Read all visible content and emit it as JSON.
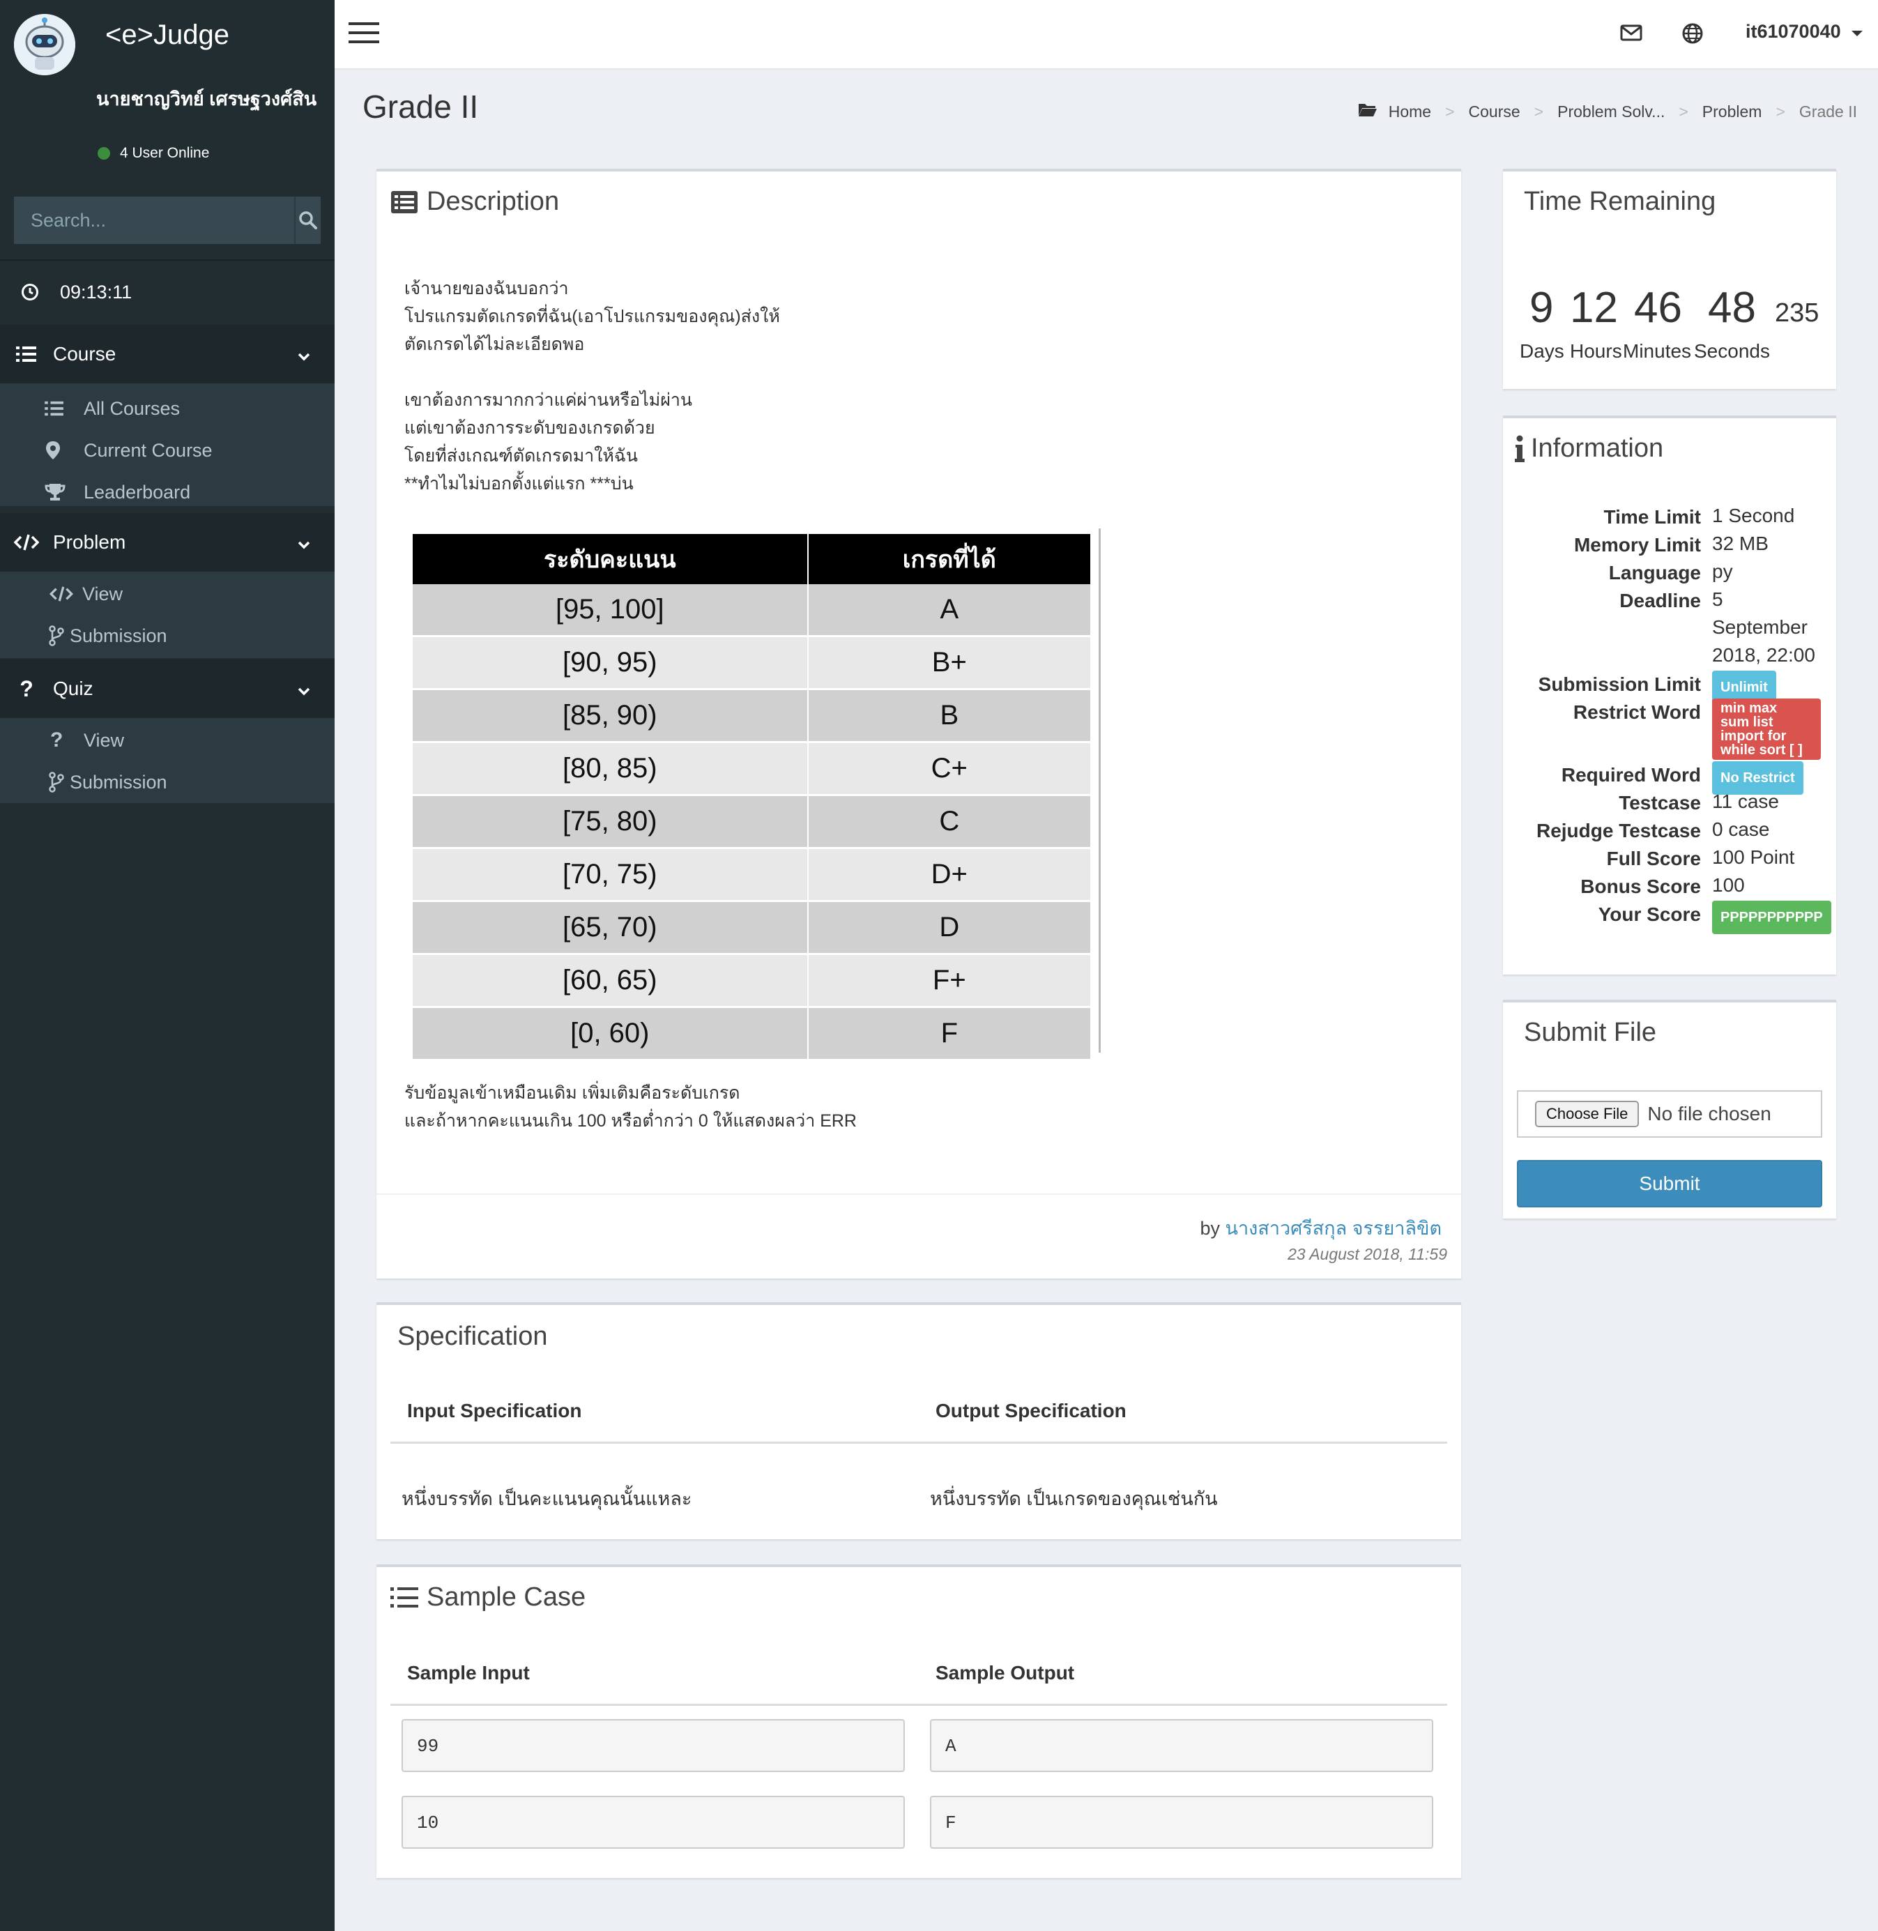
{
  "app": {
    "logo": "<e>Judge"
  },
  "user": {
    "name": "นายชาญวิทย์ เศรษฐวงศ์สิน",
    "online_text": "4 User Online",
    "username": "it61070040"
  },
  "search": {
    "placeholder": "Search..."
  },
  "clock": "09:13:11",
  "sidebar": {
    "course": {
      "label": "Course",
      "items": [
        "All Courses",
        "Current Course",
        "Leaderboard"
      ]
    },
    "problem": {
      "label": "Problem",
      "items": [
        "View",
        "Submission"
      ]
    },
    "quiz": {
      "label": "Quiz",
      "items": [
        "View",
        "Submission"
      ]
    }
  },
  "page": {
    "title": "Grade II"
  },
  "breadcrumb": [
    "Home",
    "Course",
    "Problem Solv...",
    "Problem",
    "Grade II"
  ],
  "description": {
    "title": "Description",
    "paragraph1": [
      "เจ้านายของฉันบอกว่า",
      "โปรแกรมตัดเกรดที่ฉัน(เอาโปรแกรมของคุณ)ส่งให้",
      "ตัดเกรดได้ไม่ละเอียดพอ"
    ],
    "paragraph2": [
      "เขาต้องการมากกว่าแค่ผ่านหรือไม่ผ่าน",
      "แต่เขาต้องการระดับของเกรดด้วย",
      "โดยที่ส่งเกณฑ์ตัดเกรดมาให้ฉัน",
      "**ทำไมไม่บอกตั้งแต่แรก ***บ่น"
    ],
    "table_headers": [
      "ระดับคะแนน",
      "เกรดที่ได้"
    ],
    "table_rows": [
      [
        "[95, 100]",
        "A"
      ],
      [
        "[90, 95)",
        "B+"
      ],
      [
        "[85, 90)",
        "B"
      ],
      [
        "[80, 85)",
        "C+"
      ],
      [
        "[75, 80)",
        "C"
      ],
      [
        "[70, 75)",
        "D+"
      ],
      [
        "[65, 70)",
        "D"
      ],
      [
        "[60, 65)",
        "F+"
      ],
      [
        "[0, 60)",
        "F"
      ]
    ],
    "paragraph3": [
      "รับข้อมูลเข้าเหมือนเดิม เพิ่มเติมคือระดับเกรด",
      "และถ้าหากคะแนนเกิน 100 หรือต่ำกว่า 0 ให้แสดงผลว่า ERR"
    ],
    "by_prefix": "by",
    "author": "นางสาวศรีสกุล จรรยาลิขิต",
    "date": "23 August 2018, 11:59"
  },
  "specification": {
    "title": "Specification",
    "input_header": "Input Specification",
    "output_header": "Output Specification",
    "input_text": "หนึ่งบรรทัด เป็นคะแนนคุณนั้นแหละ",
    "output_text": "หนึ่งบรรทัด เป็นเกรดของคุณเช่นกัน"
  },
  "sample": {
    "title": "Sample Case",
    "input_header": "Sample Input",
    "output_header": "Sample Output",
    "cases": [
      {
        "input": "99",
        "output": "A"
      },
      {
        "input": "10",
        "output": "F"
      }
    ]
  },
  "timer": {
    "title": "Time Remaining",
    "days": "9",
    "hours": "12",
    "minutes": "46",
    "seconds": "48",
    "ms": "235",
    "labels": [
      "Days",
      "Hours",
      "Minutes",
      "Seconds"
    ]
  },
  "information": {
    "title": "Information",
    "time_limit": {
      "label": "Time Limit",
      "value": "1 Second"
    },
    "memory_limit": {
      "label": "Memory Limit",
      "value": "32 MB"
    },
    "language": {
      "label": "Language",
      "value": "py"
    },
    "deadline": {
      "label": "Deadline",
      "value_lines": [
        "5",
        "September",
        "2018, 22:00"
      ]
    },
    "submission_limit": {
      "label": "Submission Limit",
      "value": "Unlimit"
    },
    "restrict_word": {
      "label": "Restrict Word",
      "value_lines": [
        "min max",
        "sum list",
        "import for",
        "while sort [ ]"
      ]
    },
    "required_word": {
      "label": "Required Word",
      "value": "No Restrict"
    },
    "testcase": {
      "label": "Testcase",
      "value": "11 case"
    },
    "rejudge_testcase": {
      "label": "Rejudge Testcase",
      "value": "0 case"
    },
    "full_score": {
      "label": "Full Score",
      "value": "100 Point"
    },
    "bonus_score": {
      "label": "Bonus Score",
      "value": "100"
    },
    "your_score": {
      "label": "Your Score",
      "value": "PPPPPPPPPPP"
    }
  },
  "submit": {
    "title": "Submit File",
    "choose_label": "Choose File",
    "no_file": "No file chosen",
    "button": "Submit"
  },
  "colors": {
    "sidebar": "#222d32",
    "accent": "#3c8dbc",
    "badge_info": "#5bc0de",
    "badge_danger": "#d9534f",
    "badge_success": "#5cb85c"
  }
}
